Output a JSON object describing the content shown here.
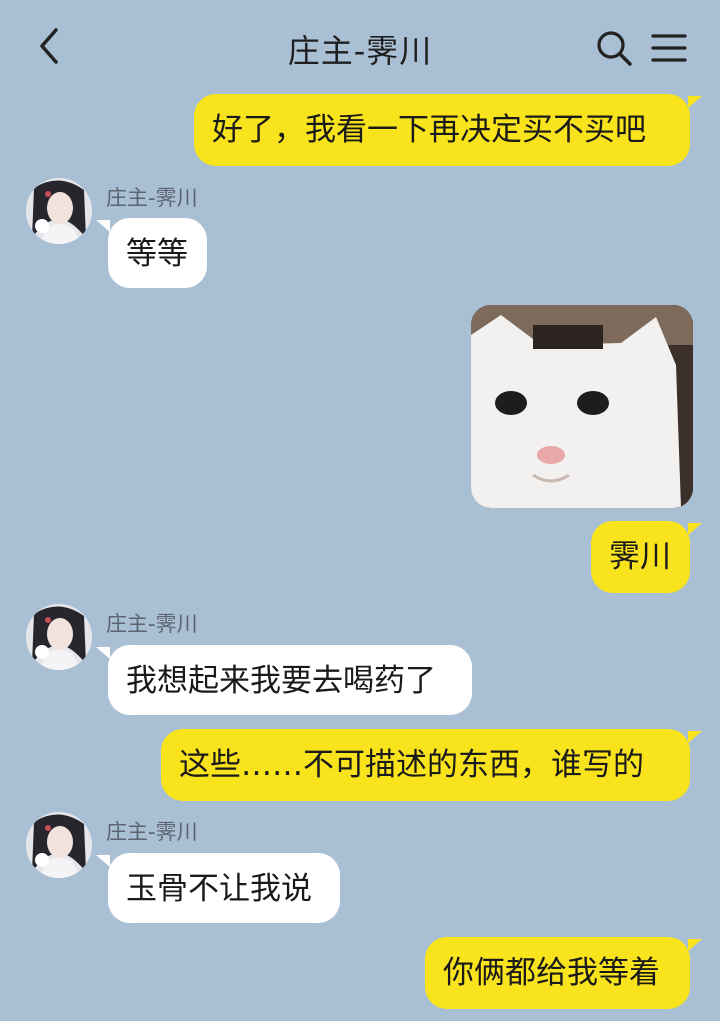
{
  "header": {
    "title": "庄主-霁川",
    "back_icon": "chevron-left-icon",
    "search_icon": "search-icon",
    "menu_icon": "menu-icon"
  },
  "colors": {
    "background": "#a9bfd3",
    "me_bubble": "#f9e31c",
    "them_bubble": "#ffffff"
  },
  "messages": [
    {
      "from": "me",
      "text": "好了，我看一下再决定买不买吧"
    },
    {
      "from": "them",
      "sender": "庄主-霁川",
      "text": "等等"
    },
    {
      "from": "me",
      "type": "sticker",
      "icon": "white-cat-sticker"
    },
    {
      "from": "me",
      "text": "霁川"
    },
    {
      "from": "them",
      "sender": "庄主-霁川",
      "text": "我想起来我要去喝药了"
    },
    {
      "from": "me",
      "text": "这些……不可描述的东西，谁写的"
    },
    {
      "from": "them",
      "sender": "庄主-霁川",
      "text": "玉骨不让我说"
    },
    {
      "from": "me",
      "text": "你俩都给我等着"
    }
  ]
}
